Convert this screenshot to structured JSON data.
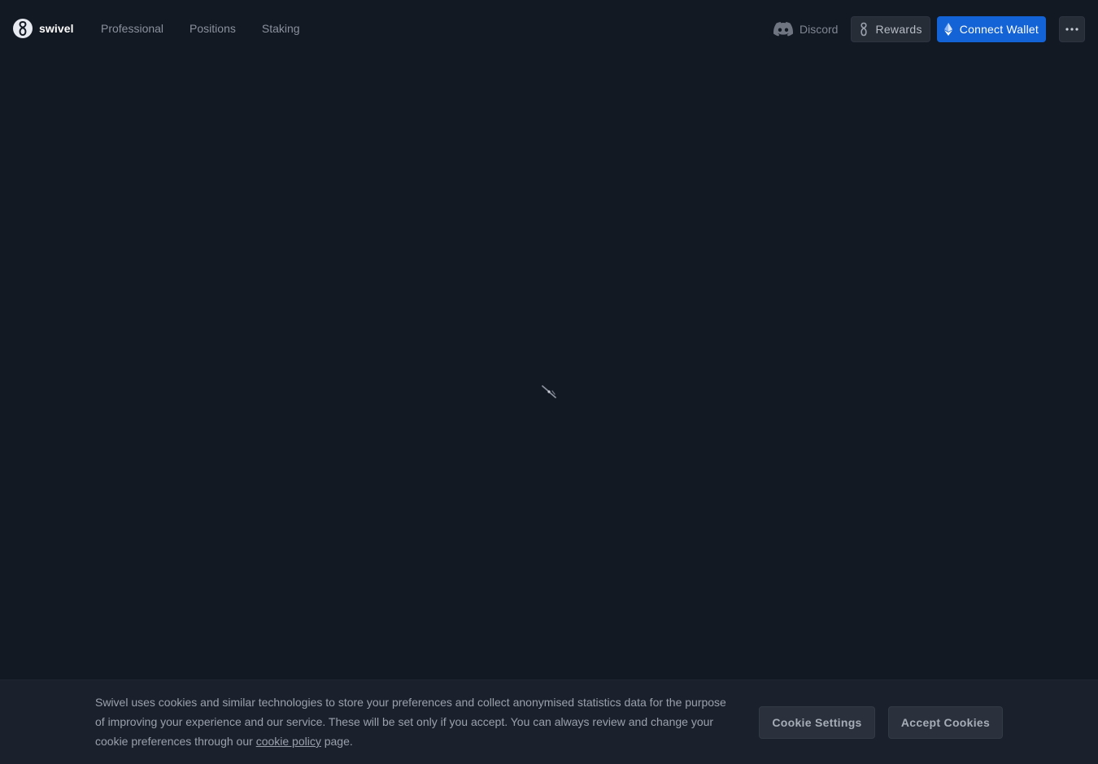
{
  "header": {
    "logo_text": "swivel",
    "nav": [
      {
        "label": "Professional"
      },
      {
        "label": "Positions"
      },
      {
        "label": "Staking"
      }
    ],
    "discord_label": "Discord",
    "rewards_label": "Rewards",
    "connect_wallet_label": "Connect Wallet"
  },
  "cookie_banner": {
    "text_before": "Swivel uses cookies and similar technologies to store your preferences and collect anonymised statistics data for the purpose of improving your experience and our service. These will be set only if you accept. You can always review and change your cookie preferences through our ",
    "link_text": "cookie policy",
    "text_after": " page.",
    "settings_label": "Cookie Settings",
    "accept_label": "Accept Cookies"
  },
  "colors": {
    "background": "#131923",
    "accent": "#1463d6",
    "banner": "#1b212c"
  }
}
